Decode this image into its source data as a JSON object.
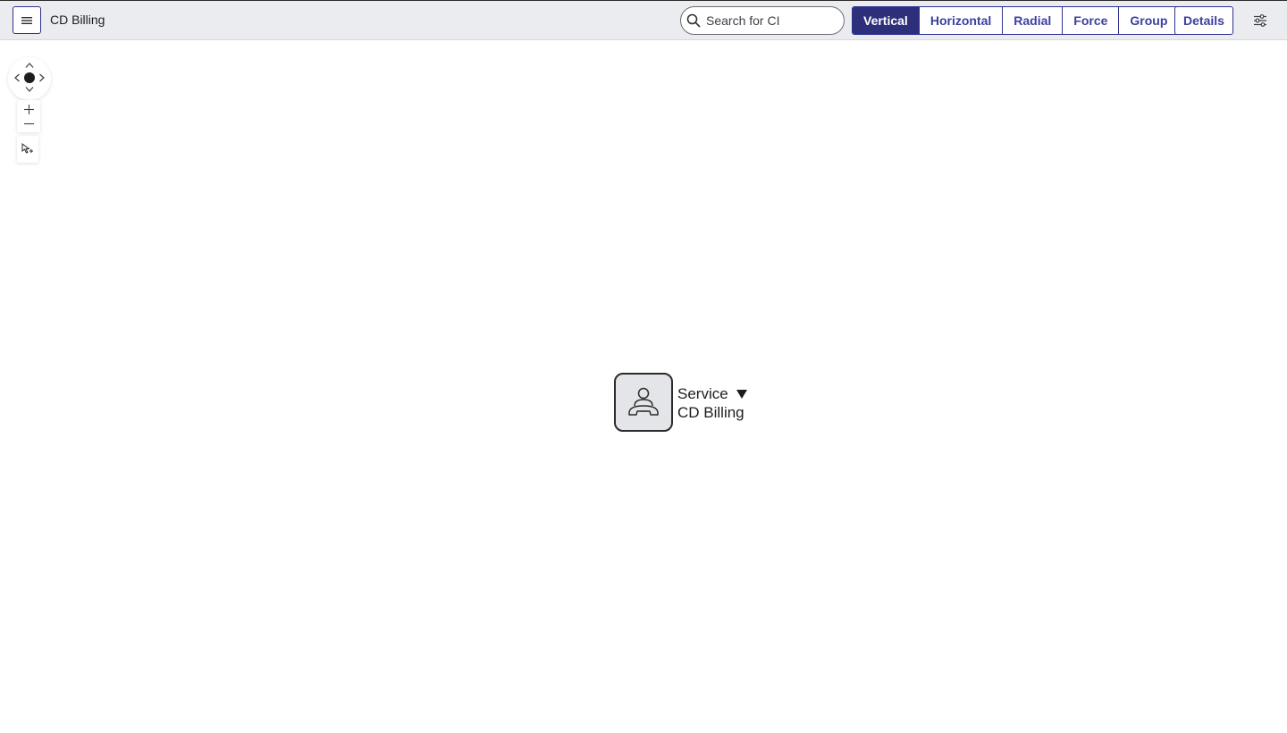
{
  "header": {
    "title": "CD Billing",
    "search_placeholder": "Search for CI",
    "layouts": [
      "Vertical",
      "Horizontal",
      "Radial",
      "Force",
      "Group"
    ],
    "active_layout": "Vertical",
    "details_label": "Details"
  },
  "node": {
    "type": "Service",
    "name": "CD Billing",
    "icon": "service-person-phone-icon"
  },
  "colors": {
    "accent": "#2e3192",
    "active_bg": "#2e2f7a",
    "header_bg": "#eaecef",
    "node_bg": "#e4e5e8"
  }
}
